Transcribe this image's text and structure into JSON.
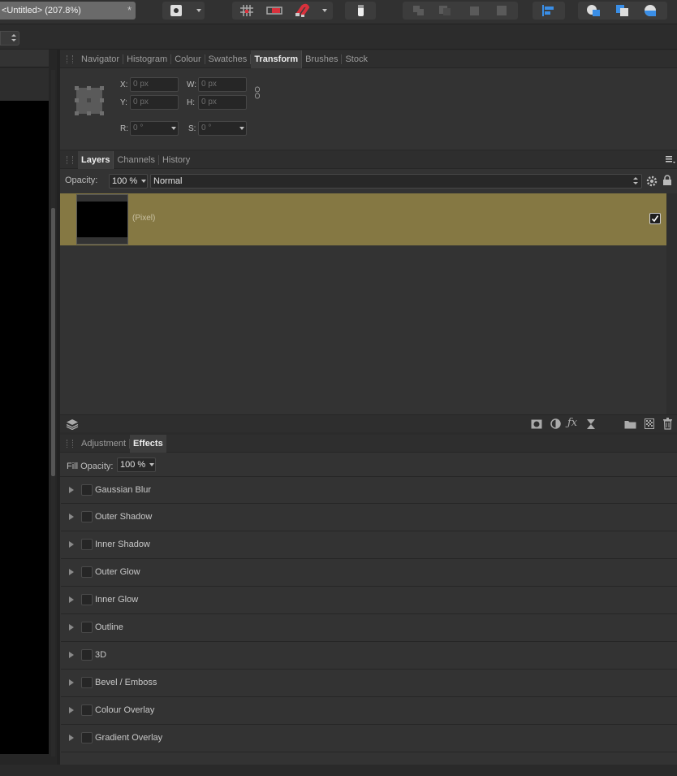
{
  "document": {
    "title": "<Untitled> (207.8%)",
    "star": "*"
  },
  "toolbar": {
    "groups": [
      "shape-mode",
      "snapping",
      "assistants",
      "arrange",
      "align",
      "boolean"
    ]
  },
  "studio_top": {
    "tabs": [
      {
        "label": "Navigator",
        "active": false
      },
      {
        "label": "Histogram",
        "active": false
      },
      {
        "label": "Colour",
        "active": false
      },
      {
        "label": "Swatches",
        "active": false
      },
      {
        "label": "Transform",
        "active": true
      },
      {
        "label": "Brushes",
        "active": false
      },
      {
        "label": "Stock",
        "active": false
      }
    ]
  },
  "transform": {
    "x_label": "X:",
    "x_value": "0 px",
    "y_label": "Y:",
    "y_value": "0 px",
    "w_label": "W:",
    "w_value": "0 px",
    "h_label": "H:",
    "h_value": "0 px",
    "r_label": "R:",
    "r_value": "0 °",
    "s_label": "S:",
    "s_value": "0 °"
  },
  "layers_panel": {
    "tabs": [
      {
        "label": "Layers",
        "active": true
      },
      {
        "label": "Channels",
        "active": false
      },
      {
        "label": "History",
        "active": false
      }
    ],
    "opacity_label": "Opacity:",
    "opacity_value": "100 %",
    "blend_mode": "Normal",
    "layers": [
      {
        "name": "(Pixel)",
        "visible": true,
        "selected": true
      }
    ],
    "selected_color": "#857843"
  },
  "effects_panel": {
    "tabs": [
      {
        "label": "Adjustment",
        "active": false
      },
      {
        "label": "Effects",
        "active": true
      }
    ],
    "fill_opacity_label": "Fill Opacity:",
    "fill_opacity_value": "100 %",
    "effects": [
      {
        "label": "Gaussian Blur"
      },
      {
        "label": "Outer Shadow"
      },
      {
        "label": "Inner Shadow"
      },
      {
        "label": "Outer Glow"
      },
      {
        "label": "Inner Glow"
      },
      {
        "label": "Outline"
      },
      {
        "label": "3D"
      },
      {
        "label": "Bevel / Emboss"
      },
      {
        "label": "Colour Overlay"
      },
      {
        "label": "Gradient Overlay"
      }
    ]
  },
  "colors": {
    "accent_blue": "#3a8ee6",
    "snap_red": "#d9313c"
  }
}
